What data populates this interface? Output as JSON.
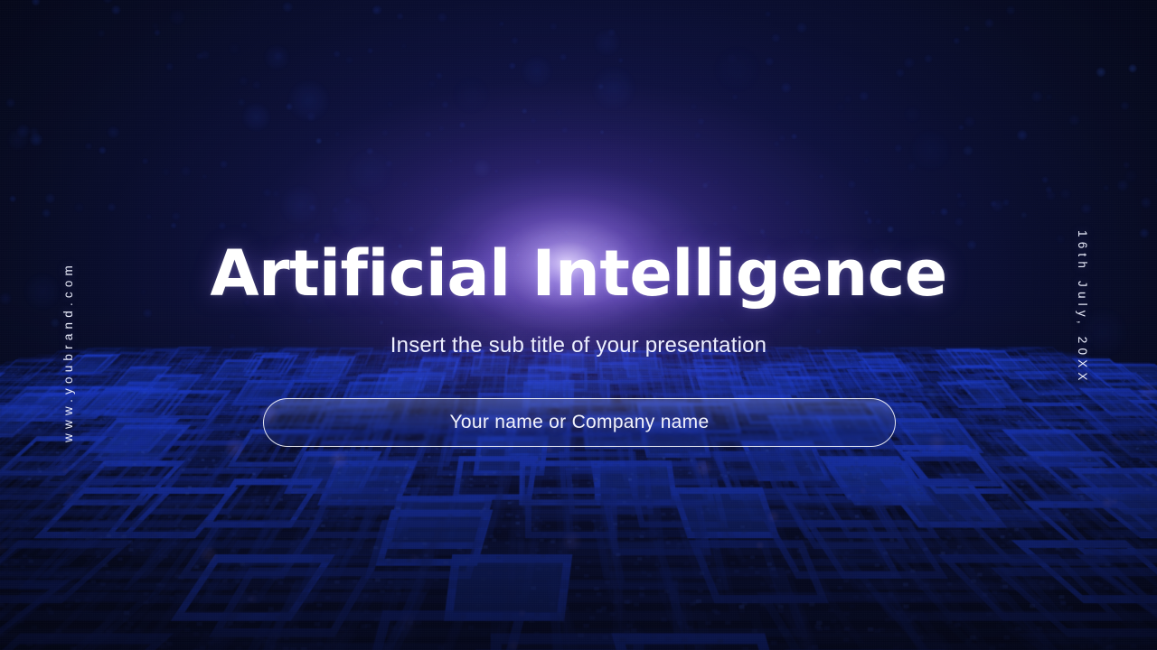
{
  "slide": {
    "title": "Artificial Intelligence",
    "subtitle": "Insert the sub title of your presentation",
    "name_placeholder": "Your name or Company name",
    "website": "www.youbrand.com",
    "date": "16th July, 20XX",
    "theme": {
      "background_deep": "#080d28",
      "background_mid": "#0c1038",
      "glow_core": "#e2d6ff",
      "glow_purple": "#7e58e0",
      "grid_blue": "#1e3ccc",
      "accent_blue": "#2244ee",
      "text_primary": "#ffffff",
      "text_secondary": "#eef0ff"
    }
  }
}
